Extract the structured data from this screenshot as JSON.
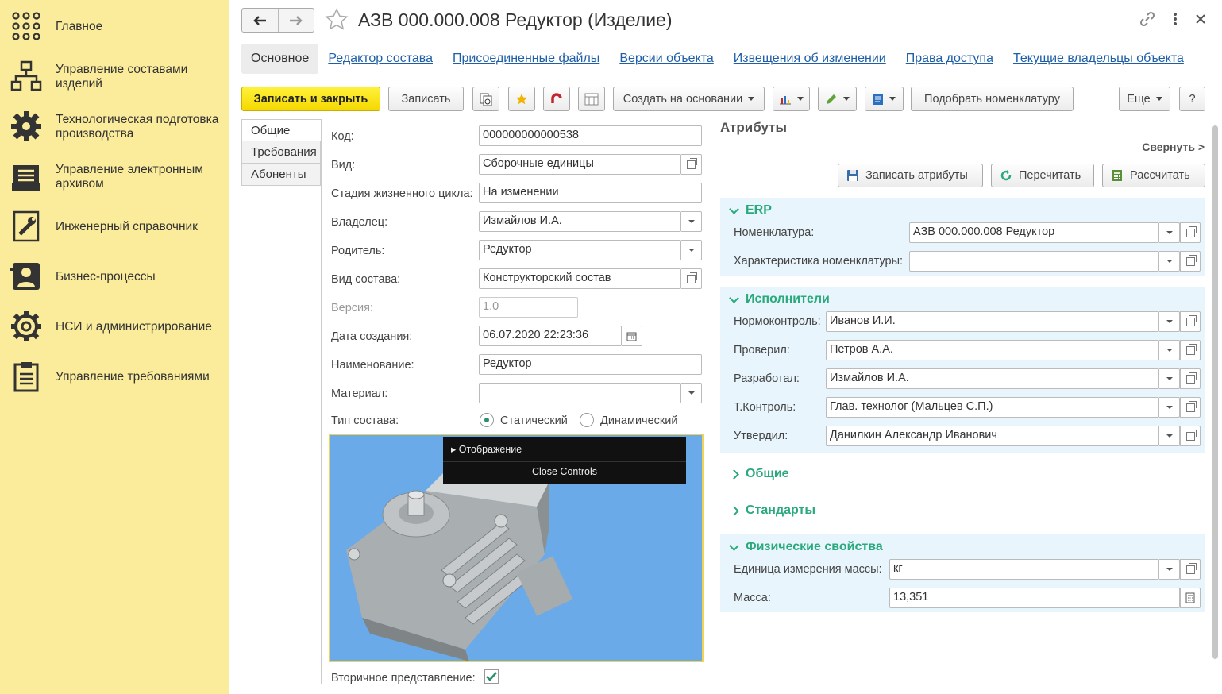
{
  "sidebar": {
    "items": [
      {
        "label": "Главное",
        "icon": "grid-dots-icon"
      },
      {
        "label": "Управление составами изделий",
        "icon": "hierarchy-icon"
      },
      {
        "label": "Технологическая подготовка производства",
        "icon": "gear-wrench-icon"
      },
      {
        "label": "Управление электронным архивом",
        "icon": "archive-icon"
      },
      {
        "label": "Инженерный справочник",
        "icon": "wrench-book-icon"
      },
      {
        "label": "Бизнес-процессы",
        "icon": "person-card-icon"
      },
      {
        "label": "НСИ и администрирование",
        "icon": "gear-icon"
      },
      {
        "label": "Управление требованиями",
        "icon": "clipboard-icon"
      }
    ]
  },
  "header": {
    "title": "АЗВ 000.000.008 Редуктор (Изделие)"
  },
  "tabs": [
    {
      "label": "Основное",
      "active": true
    },
    {
      "label": "Редактор состава"
    },
    {
      "label": "Присоединенные файлы"
    },
    {
      "label": "Версии объекта"
    },
    {
      "label": "Извещения об изменении"
    },
    {
      "label": "Права доступа"
    },
    {
      "label": "Текущие владельцы объекта"
    }
  ],
  "toolbar": {
    "save_close": "Записать и закрыть",
    "save": "Записать",
    "create_based": "Создать на основании",
    "pick_nomenclature": "Подобрать номенклатуру",
    "more": "Еще",
    "help": "?"
  },
  "vtabs": [
    "Общие",
    "Требования",
    "Абоненты"
  ],
  "form": {
    "code_label": "Код:",
    "code": "000000000000538",
    "kind_label": "Вид:",
    "kind": "Сборочные единицы",
    "stage_label": "Стадия жизненного цикла:",
    "stage": "На изменении",
    "owner_label": "Владелец:",
    "owner": "Измайлов И.А.",
    "parent_label": "Родитель:",
    "parent": "Редуктор",
    "composition_label": "Вид состава:",
    "composition": "Конструкторский состав",
    "version_label": "Версия:",
    "version": "1.0",
    "created_label": "Дата создания:",
    "created": "06.07.2020 22:23:36",
    "name_label": "Наименование:",
    "name": "Редуктор",
    "material_label": "Материал:",
    "material": "",
    "type_label": "Тип состава:",
    "type_static": "Статический",
    "type_dynamic": "Динамический",
    "secondary_label": "Вторичное представление:"
  },
  "viewer": {
    "display": "Отображение",
    "close_controls": "Close Controls"
  },
  "attributes": {
    "title": "Атрибуты",
    "collapse": "Свернуть >",
    "save_attrs": "Записать атрибуты",
    "reread": "Перечитать",
    "calculate": "Рассчитать",
    "erp": {
      "title": "ERP",
      "nomenclature_label": "Номенклатура:",
      "nomenclature": "АЗВ 000.000.008 Редуктор",
      "characteristic_label": "Характеристика номенклатуры:",
      "characteristic": ""
    },
    "executors": {
      "title": "Исполнители",
      "normcontrol_label": "Нормоконтроль:",
      "normcontrol": "Иванов И.И.",
      "checked_label": "Проверил:",
      "checked": "Петров А.А.",
      "developed_label": "Разработал:",
      "developed": "Измайлов И.А.",
      "tcontrol_label": "Т.Контроль:",
      "tcontrol": "Глав. технолог (Мальцев С.П.)",
      "approved_label": "Утвердил:",
      "approved": "Данилкин Александр Иванович"
    },
    "general": {
      "title": "Общие"
    },
    "standards": {
      "title": "Стандарты"
    },
    "physical": {
      "title": "Физические свойства",
      "mass_unit_label": "Единица измерения массы:",
      "mass_unit": "кг",
      "mass_label": "Масса:",
      "mass": "13,351"
    }
  },
  "colors": {
    "sidebar": "#fbec9c",
    "accent_green": "#2aa97c",
    "link": "#1f5fa8",
    "primary_button": "#f5d800"
  }
}
